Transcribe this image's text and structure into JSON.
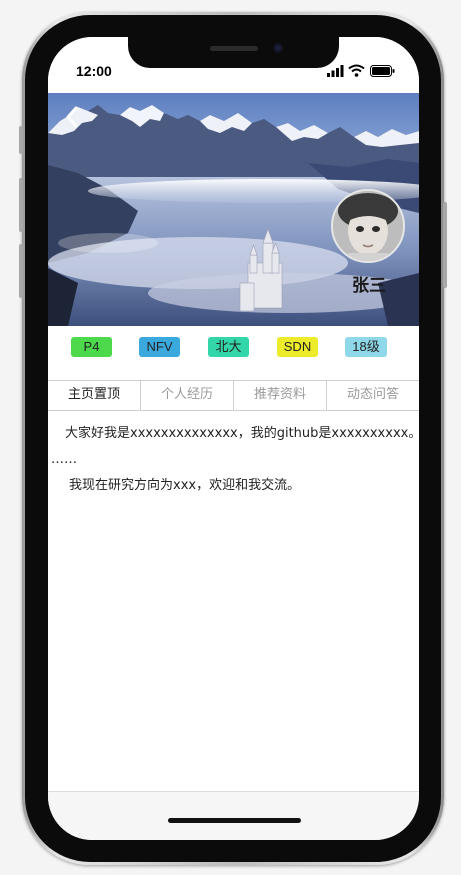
{
  "status_bar": {
    "time": "12:00",
    "icons": [
      "signal-icon",
      "wifi-icon",
      "battery-icon"
    ]
  },
  "header": {
    "back_icon": "chevron-left-icon",
    "avatar_icon": "child-avatar",
    "user_name": "张三"
  },
  "tags": [
    {
      "label": "P4",
      "color": "#4cd94c"
    },
    {
      "label": "NFV",
      "color": "#3aa9de"
    },
    {
      "label": "北大",
      "color": "#33d6a8"
    },
    {
      "label": "SDN",
      "color": "#ecec2a"
    },
    {
      "label": "18级",
      "color": "#8ed8ea"
    }
  ],
  "tabs": [
    {
      "label": "主页置顶",
      "active": true
    },
    {
      "label": "个人经历",
      "active": false
    },
    {
      "label": "推荐资料",
      "active": false
    },
    {
      "label": "动态问答",
      "active": false
    }
  ],
  "content": {
    "line1": "大家好我是xxxxxxxxxxxxxx，我的github是xxxxxxxxxx。",
    "line2": "……",
    "line3": "我现在研究方向为xxx，欢迎和我交流。"
  }
}
